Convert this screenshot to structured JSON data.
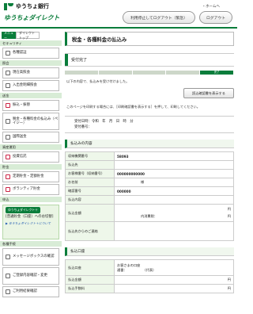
{
  "header": {
    "bank_name": "ゆうちょ銀行",
    "service_name": "ゆうちょダイレクト",
    "home_link": "・ホームへ",
    "pause_logout_label": "利用停止してログアウト（緊急）",
    "logout_label": "ログアウト"
  },
  "sidebar": {
    "tab_menu": "メニュー",
    "tab_direct_top": "ダイレクトトップ",
    "sections": [
      {
        "title": "セキュリティ",
        "items": [
          "各種認証"
        ]
      },
      {
        "title": "照会",
        "items": [
          "現在高照会",
          "入出金明細照会"
        ]
      },
      {
        "title": "送金",
        "items": [
          "振込・振替",
          "税金・各種料金の払込み（ペイジー）",
          "国際送金"
        ]
      },
      {
        "title": "資産運用",
        "items": [
          "投資信託"
        ]
      },
      {
        "title": "貯金",
        "items": [
          "定期貯金・定額貯金",
          "ボランティア貯金"
        ]
      },
      {
        "title": "申込",
        "items": []
      },
      {
        "title": "各種手続",
        "items": [
          "メッセージボックスの確認",
          "ご登録内容確認・変更",
          "ご利用結果確認"
        ]
      }
    ],
    "promo_badge": "ゆうちょダイレクト＋",
    "promo_text": "[普通貯金（口座）へのお切替]",
    "promo_link": "▶ ゆうちょダイレクト＋について"
  },
  "main": {
    "page_title": "税金・各種料金の払込み",
    "status_label": "受付完了",
    "progress_current_label": "完了",
    "progress_steps_total": 5,
    "progress_current_index": 4,
    "message1": "以下の内容で、払込みを受け付けました。",
    "view_receipt_label": "読込確認書を表示する",
    "message2": "このページを印刷する場合には、［印刷確認書を表示する］を押して、印刷してください。",
    "accepted_datetime_label": "受付日時：令和　年　月　日　時　分",
    "accepted_number_label": "受付番号：",
    "payment_section_title": "払込みの内容",
    "payment_rows": [
      {
        "key": "収納機関番号",
        "value": "58093",
        "bold": true
      },
      {
        "key": "払込先",
        "value": ""
      },
      {
        "key": "お客様番号（収納番号）",
        "value": "000000000000",
        "bold": true
      },
      {
        "key": "お名前",
        "value": "様"
      },
      {
        "key": "確認番号",
        "value": "000000",
        "bold": true
      },
      {
        "key": "払込内容",
        "value": ""
      },
      {
        "key": "払込金額",
        "value": "円",
        "sub": "内消費税：",
        "sub_unit": "円"
      },
      {
        "key": "払込先からのご連絡",
        "value": ""
      }
    ],
    "account_section_title": "払込口座",
    "account_rows": [
      {
        "key": "払込口座",
        "line1": "お客さまの口座",
        "line2": "通番：",
        "line2b": "（代表）"
      },
      {
        "key": "払込金額",
        "value": "円"
      },
      {
        "key": "払込手数料",
        "value": "円"
      }
    ]
  }
}
